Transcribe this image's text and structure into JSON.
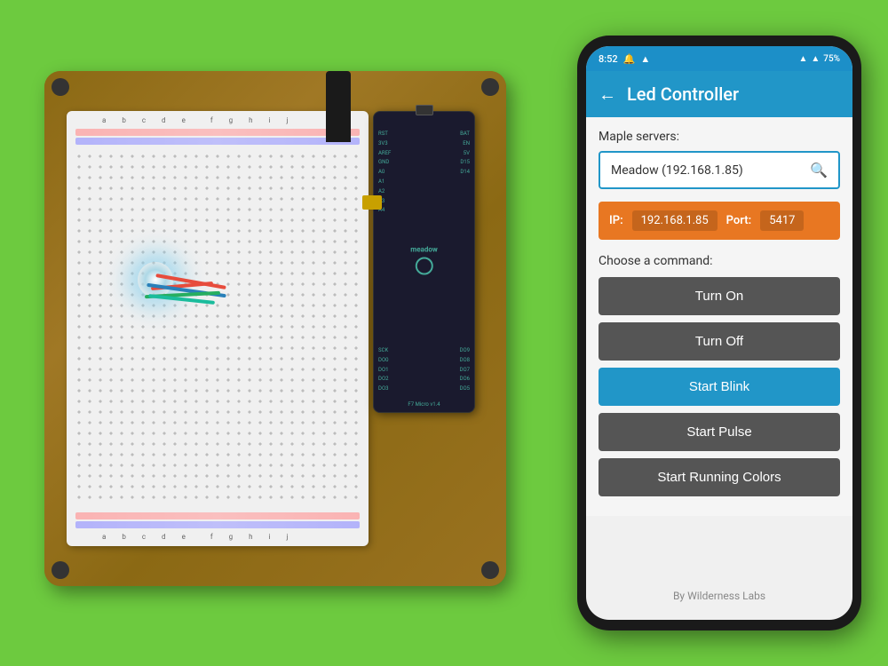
{
  "background_color": "#6dca3f",
  "phone": {
    "status_bar": {
      "time": "8:52",
      "icons": "🔔 ▲",
      "wifi": "▲",
      "battery": "75%"
    },
    "header": {
      "back_label": "←",
      "title": "Led Controller"
    },
    "server_section": {
      "label": "Maple servers:",
      "selected_server": "Meadow (192.168.1.85)",
      "search_icon": "🔍"
    },
    "ip_section": {
      "ip_label": "IP:",
      "ip_value": "192.168.1.85",
      "port_label": "Port:",
      "port_value": "5417"
    },
    "command_section": {
      "label": "Choose a command:",
      "buttons": [
        {
          "id": "turn-on",
          "label": "Turn On",
          "style": "gray"
        },
        {
          "id": "turn-off",
          "label": "Turn Off",
          "style": "gray"
        },
        {
          "id": "start-blink",
          "label": "Start Blink",
          "style": "blue"
        },
        {
          "id": "start-pulse",
          "label": "Start Pulse",
          "style": "gray"
        },
        {
          "id": "start-running-colors",
          "label": "Start Running Colors",
          "style": "gray"
        }
      ]
    },
    "footer": "By Wilderness Labs"
  }
}
